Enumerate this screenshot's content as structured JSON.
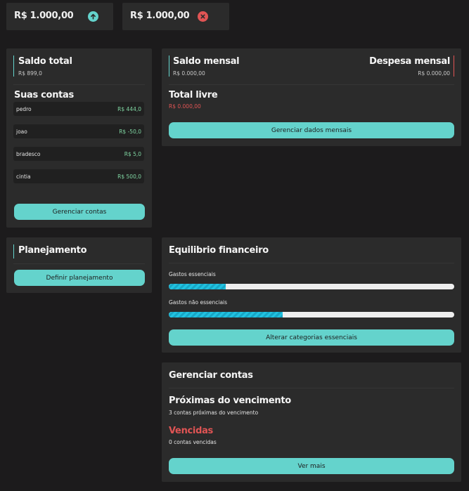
{
  "top": {
    "income": {
      "amount": "R$ 1.000,00",
      "icon": "arrow-up-icon",
      "color": "#64d3cc"
    },
    "expense": {
      "amount": "R$ 1.000,00",
      "icon": "close-icon",
      "color": "#e05454"
    }
  },
  "saldo_total": {
    "title": "Saldo total",
    "value": "R$ 899,0",
    "accounts_title": "Suas contas",
    "accounts": [
      {
        "name": "pedro",
        "value": "R$ 444,0"
      },
      {
        "name": "joao",
        "value": "R$ -50,0"
      },
      {
        "name": "bradesco",
        "value": "R$ 5,0"
      },
      {
        "name": "cintia",
        "value": "R$ 500,0"
      }
    ],
    "button": "Gerenciar contas"
  },
  "mensal": {
    "saldo_title": "Saldo mensal",
    "saldo_value": "R$ 0.000,00",
    "despesa_title": "Despesa mensal",
    "despesa_value": "R$ 0.000,00",
    "livre_title": "Total livre",
    "livre_value": "R$ 0.000,00",
    "button": "Gerenciar dados mensais"
  },
  "planejamento": {
    "title": "Planejamento",
    "button": "Definir planejamento"
  },
  "equilibrio": {
    "title": "Equilibrio financeiro",
    "bars": [
      {
        "label": "Gastos essenciais",
        "fraction": 0.2
      },
      {
        "label": "Gastos não essenciais",
        "fraction": 0.4
      }
    ],
    "button": "Alterar categorias essenciais"
  },
  "gerenciar": {
    "title": "Gerenciar contas",
    "proximas_title": "Próximas do vencimento",
    "proximas_sub": "3 contas próximas do vencimento",
    "vencidas_title": "Vencidas",
    "vencidas_sub": "0 contas vencidas",
    "button": "Ver mais"
  },
  "colors": {
    "accent": "#64d3cc",
    "danger": "#e05454",
    "positive": "#7fd6a2",
    "card": "#2b2b2b",
    "background": "#1c1b1c"
  }
}
